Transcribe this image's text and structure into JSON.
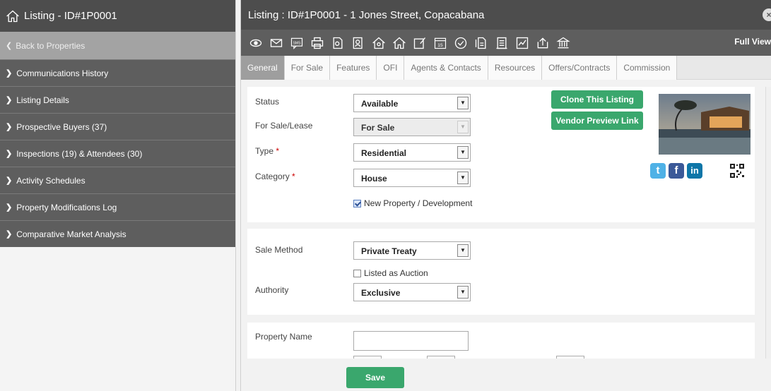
{
  "left_panel": {
    "title": "Listing - ID#1P0001",
    "back_label": "Back to Properties",
    "items": [
      {
        "label": "Communications History"
      },
      {
        "label": "Listing Details"
      },
      {
        "label": "Prospective Buyers (37)"
      },
      {
        "label": "Inspections (19) & Attendees (30)"
      },
      {
        "label": "Activity Schedules"
      },
      {
        "label": "Property Modifications Log"
      },
      {
        "label": "Comparative Market Analysis"
      }
    ]
  },
  "right_panel": {
    "title": "Listing : ID#1P0001 - 1 Jones Street, Copacabana",
    "close_icon": "×",
    "full_view_label": "Full View",
    "toolbar_icons": [
      "eye-icon",
      "envelope-icon",
      "sms-icon",
      "print-icon",
      "document-icon",
      "contacts-icon",
      "house-buyer-icon",
      "house-icon",
      "edit-icon",
      "calendar-icon",
      "check-circle-icon",
      "report-icon",
      "list-icon",
      "chart-icon",
      "upload-icon",
      "bank-icon"
    ],
    "calendar_day": "15",
    "sms_text": "SMS",
    "tabs": [
      {
        "label": "General",
        "active": true
      },
      {
        "label": "For Sale"
      },
      {
        "label": "Features"
      },
      {
        "label": "OFI"
      },
      {
        "label": "Agents & Contacts"
      },
      {
        "label": "Resources"
      },
      {
        "label": "Offers/Contracts"
      },
      {
        "label": "Commission"
      }
    ]
  },
  "general": {
    "status_label": "Status",
    "status_value": "Available",
    "for_sale_lease_label": "For Sale/Lease",
    "for_sale_lease_value": "For Sale",
    "type_label": "Type",
    "type_value": "Residential",
    "category_label": "Category",
    "category_value": "House",
    "required_mark": "*",
    "new_property_label": "New Property / Development",
    "new_property_checked": true,
    "clone_button": "Clone This Listing",
    "vendor_preview_button": "Vendor Preview Link",
    "social": {
      "twitter": "t",
      "facebook": "f",
      "linkedin": "in"
    }
  },
  "sale": {
    "sale_method_label": "Sale Method",
    "sale_method_value": "Private Treaty",
    "listed_auction_label": "Listed as Auction",
    "listed_auction_checked": false,
    "authority_label": "Authority",
    "authority_value": "Exclusive"
  },
  "property": {
    "property_name_label": "Property Name",
    "property_name_value": ""
  },
  "footer": {
    "save_label": "Save"
  },
  "colors": {
    "header_dark": "#4d4d4d",
    "nav_gray": "#5e5e5e",
    "accent_green": "#3aa76d",
    "twitter_blue": "#4fb1e6",
    "facebook_blue": "#3b5998",
    "linkedin_blue": "#0e76a8"
  }
}
